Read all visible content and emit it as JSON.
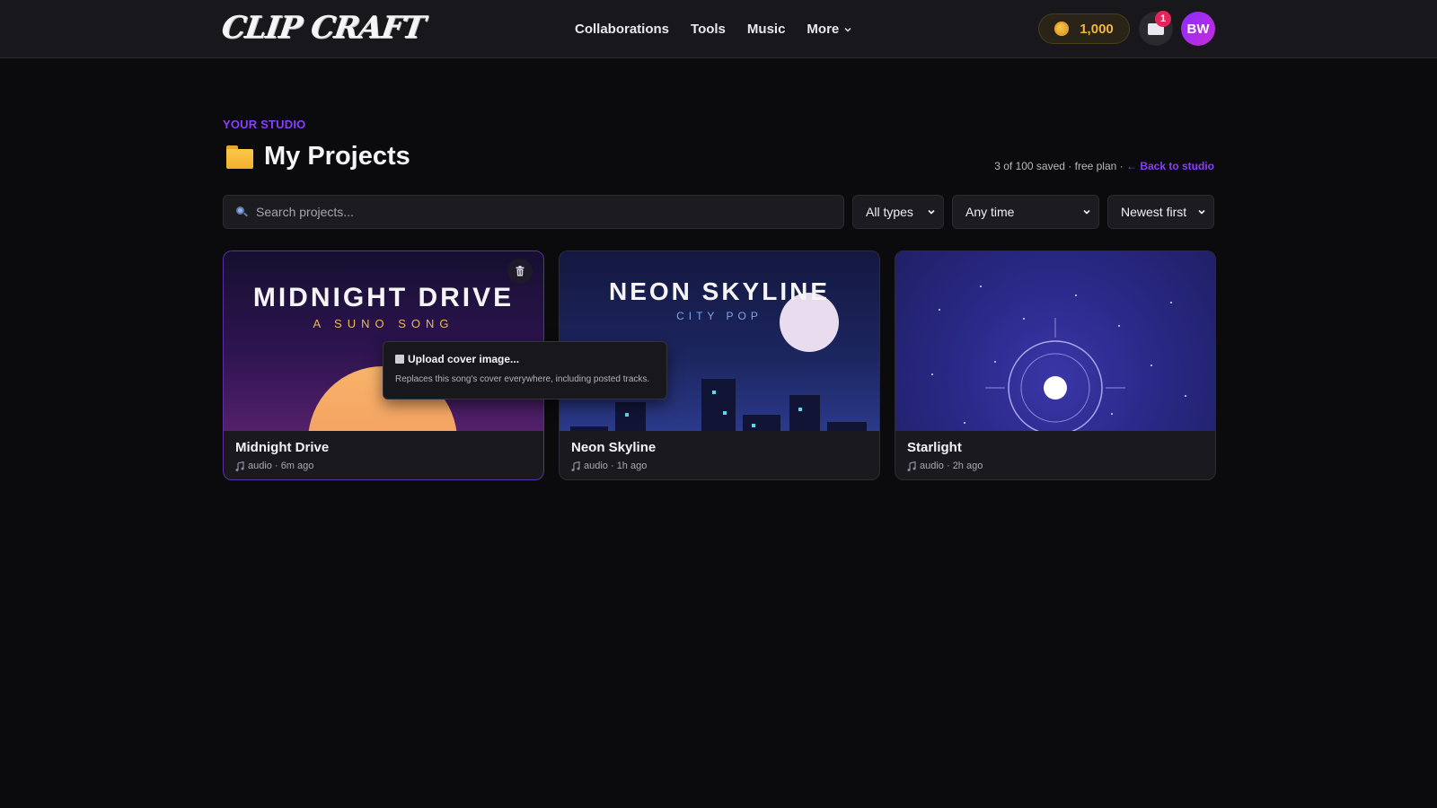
{
  "app": {
    "logo": "CLIP CRAFT"
  },
  "nav": {
    "items": [
      "Collaborations",
      "Tools",
      "Music"
    ],
    "more": "More"
  },
  "account": {
    "coins": "1,000",
    "notifications": "1",
    "avatar_initials": "BW"
  },
  "header": {
    "eyebrow": "YOUR STUDIO",
    "title": "My Projects",
    "meta": "3 of 100 saved · free plan · ",
    "back_link": "← Back to studio"
  },
  "filters": {
    "search_placeholder": "Search projects...",
    "type": "All types",
    "time": "Any time",
    "sort": "Newest first"
  },
  "projects": [
    {
      "title": "Midnight Drive",
      "type": "audio",
      "age": "6m ago",
      "sub": "audio · 6m ago",
      "cover_title": "MIDNIGHT DRIVE",
      "cover_sub": "A SUNO SONG"
    },
    {
      "title": "Neon Skyline",
      "type": "audio",
      "age": "1h ago",
      "sub": "audio · 1h ago",
      "cover_title": "NEON SKYLINE",
      "cover_sub": "CITY POP"
    },
    {
      "title": "Starlight",
      "type": "audio",
      "age": "2h ago",
      "sub": "audio · 2h ago"
    }
  ],
  "tooltip": {
    "title": "Upload cover image...",
    "description": "Replaces this song's cover everywhere, including posted tracks."
  },
  "colors": {
    "accent": "#8a3cff",
    "coin": "#f4b63a",
    "badge": "#e5245c",
    "background": "#0b0a0c"
  },
  "icons": [
    "coin-icon",
    "envelope-icon",
    "search-icon",
    "chevron-down-icon",
    "folder-icon",
    "trash-icon",
    "music-note-icon",
    "image-icon"
  ]
}
